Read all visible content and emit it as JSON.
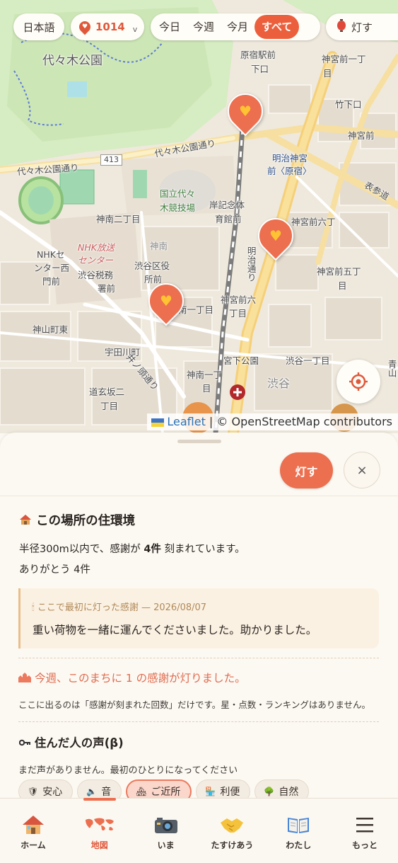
{
  "topbar": {
    "language": "日本語",
    "count": "1014",
    "count_caret": "v",
    "periods": [
      "今日",
      "今週",
      "今月",
      "すべて"
    ],
    "active_period": "すべて",
    "light_chip": "灯す"
  },
  "map": {
    "labels": {
      "yoyogi_park": "代々木公園",
      "harajuku_station": "原宿駅前",
      "harajuku_station2": "下口",
      "jingumae1": "神宮前一丁",
      "jingumae1b": "目",
      "takeshita": "竹下口",
      "jingumae": "神宮前",
      "route413": "413",
      "yoyogi_dori1": "代々木公園通り",
      "yoyogi_dori2": "代々木公園通り",
      "meiji_jingu1": "明治神宮",
      "meiji_jingu2": "前〈原宿〉",
      "omotesando": "表参道",
      "national_stadium1": "国立代々",
      "national_stadium2": "木競技場",
      "kishi1": "岸記念体",
      "kishi2": "育館前",
      "jinnan2": "神南二丁目",
      "jinnan": "神南",
      "jingumae6": "神宮前六丁",
      "nhk1": "NHKセ",
      "nhk2": "ンター西",
      "nhk3": "門前",
      "nhk_hoso1": "NHK放送",
      "nhk_hoso2": "センター",
      "shibuya_tax1": "渋谷税務",
      "shibuya_tax2": "署前",
      "shibuya_ward1": "渋谷区役",
      "shibuya_ward2": "所前",
      "jingumae5a": "神宮前五丁",
      "jingumae5b": "目",
      "jingumae6b": "神宮前六",
      "jingumae6c": "丁目",
      "jinnan1a": "南一丁目",
      "kamiyama": "神山町東",
      "udagawa": "宇田川町",
      "jinnan1b": "神南一丁",
      "jinnan1c": "目",
      "miyashita": "宮下公園",
      "shibuya1": "渋谷一丁目",
      "shibuya": "渋谷",
      "dogenzaka1": "道玄坂二",
      "dogenzaka2": "丁目",
      "meiji_dori": "明治通り",
      "aoyama": "青山",
      "inokashira": "井ノ頭通り"
    }
  },
  "attribution": {
    "leaflet": "Leaflet",
    "rest": " | © OpenStreetMap contributors"
  },
  "sheet": {
    "light_button": "灯す",
    "close_button": "×",
    "env_title": "この場所の住環境",
    "env_line1_a": "半径300m以内で、感謝が ",
    "env_line1_b": "4件",
    "env_line1_c": " 刻まれています。",
    "env_line2": "ありがとう 4件",
    "first_meta": "ここで最初に灯った感謝 — 2026/08/07",
    "first_text": "重い荷物を一緒に運んでくださいました。助かりました。",
    "weekly": "今週、このまちに 1 の感謝が灯りました。",
    "disclaimer": "ここに出るのは「感謝が刻まれた回数」だけです。星・点数・ランキングはありません。",
    "voices_title": "住んだ人の声(β)",
    "voices_empty": "まだ声がありません。最初のひとりになってください",
    "tags": [
      "安心",
      "音",
      "ご近所",
      "利便",
      "自然"
    ],
    "selected_tag": "ご近所"
  },
  "nav": {
    "items": [
      {
        "label": "ホーム",
        "icon": "home-icon"
      },
      {
        "label": "地図",
        "icon": "map-icon"
      },
      {
        "label": "いま",
        "icon": "camera-icon"
      },
      {
        "label": "たすけあう",
        "icon": "handshake-icon"
      },
      {
        "label": "わたし",
        "icon": "book-icon"
      },
      {
        "label": "もっと",
        "icon": "menu-icon"
      }
    ],
    "active": "地図"
  },
  "colors": {
    "accent": "#ec6f4f",
    "accent_dark": "#e0583a",
    "pin_heart": "#ffc233",
    "background": "#fbf8f1"
  }
}
